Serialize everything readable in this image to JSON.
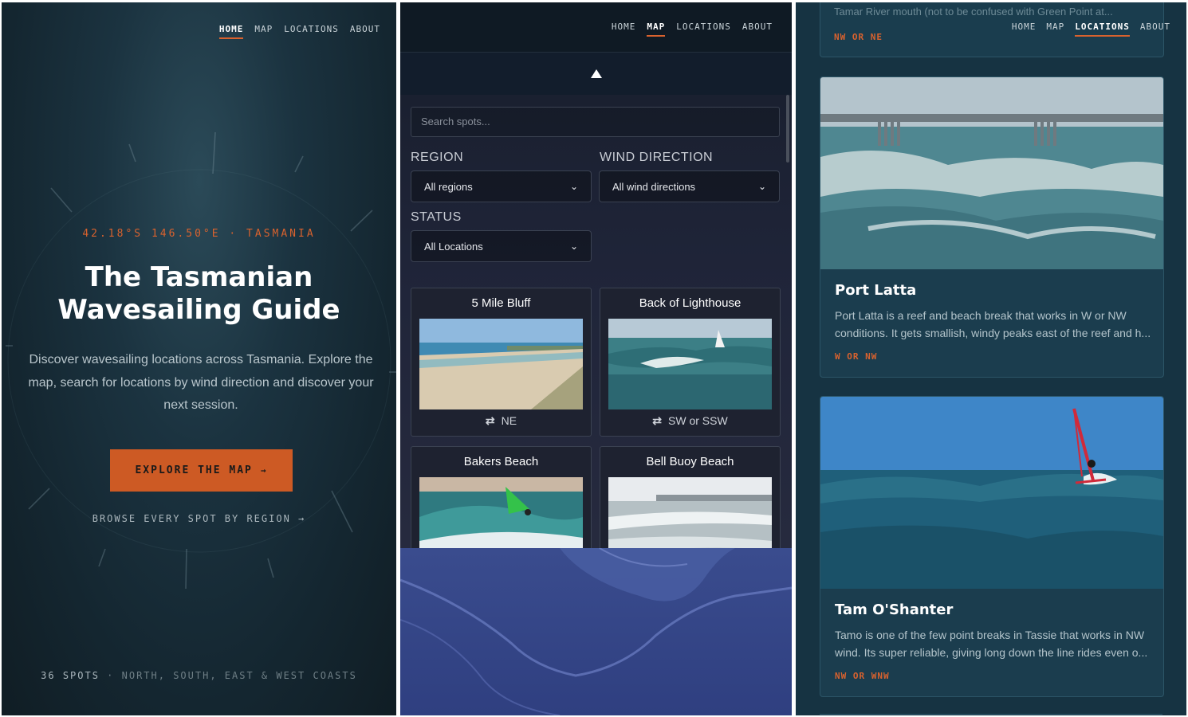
{
  "nav": {
    "home": "HOME",
    "map": "MAP",
    "locations": "LOCATIONS",
    "about": "ABOUT"
  },
  "home_panel": {
    "coords": "42.18°S 146.50°E · TASMANIA",
    "title_line1": "The Tasmanian",
    "title_line2": "Wavesailing Guide",
    "description": "Discover wavesailing locations across Tasmania. Explore the map, search for locations by wind direction and discover your next session.",
    "cta_label": "EXPLORE THE MAP",
    "cta_arrow": "→",
    "browse_label": "BROWSE EVERY SPOT BY REGION →",
    "footer_count": "36 SPOTS",
    "footer_rest": " · NORTH, SOUTH, EAST & WEST COASTS"
  },
  "map_panel": {
    "search_placeholder": "Search spots...",
    "region_label": "REGION",
    "region_value": "All regions",
    "wind_label": "WIND DIRECTION",
    "wind_value": "All wind directions",
    "status_label": "STATUS",
    "status_value": "All Locations",
    "spots": [
      {
        "name": "5 Mile Bluff",
        "wind": "NE"
      },
      {
        "name": "Back of Lighthouse",
        "wind": "SW or SSW"
      },
      {
        "name": "Bakers Beach",
        "wind": ""
      },
      {
        "name": "Bell Buoy Beach",
        "wind": ""
      }
    ]
  },
  "locations_panel": {
    "prev_desc": "Tamar River mouth (not to be confused with Green Point at...",
    "prev_tag": "NW OR NE",
    "cards": [
      {
        "title": "Port Latta",
        "desc": "Port Latta is a reef and beach break that works in W or NW conditions. It gets smallish, windy peaks east of the reef and h...",
        "tag": "W OR NW"
      },
      {
        "title": "Tam O'Shanter",
        "desc": "Tamo is one of the few point breaks in Tassie that works in NW wind. Its super reliable, giving long down the line rides even o...",
        "tag": "NW OR WNW"
      }
    ]
  },
  "colors": {
    "accent": "#d9622e",
    "cta_bg": "#cd5a24",
    "home_bg": "#1b3340",
    "map_bg": "#1c2032",
    "locations_bg": "#163342"
  }
}
